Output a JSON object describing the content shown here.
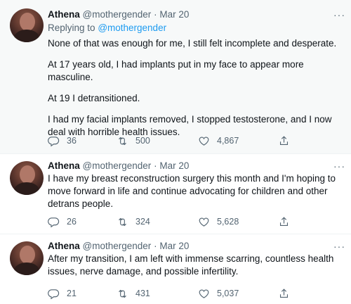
{
  "tweets": [
    {
      "name": "Athena",
      "handle": "@mothergender",
      "separator": "·",
      "date": "Mar 20",
      "replying_prefix": "Replying to",
      "replying_mention": "@mothergender",
      "paragraphs": [
        "None of that was enough for me, I still felt incomplete and desperate.",
        "At 17 years old, I had implants put in my face to appear more masculine.",
        "At 19 I detransitioned.",
        "I had my facial implants removed, I stopped testosterone, and I now deal with horrible health issues."
      ],
      "replies": "36",
      "retweets": "500",
      "likes": "4,867"
    },
    {
      "name": "Athena",
      "handle": "@mothergender",
      "separator": "·",
      "date": "Mar 20",
      "paragraphs": [
        "I have my breast reconstruction surgery this month and I'm hoping to move forward in life and continue advocating for children and other detrans people."
      ],
      "replies": "26",
      "retweets": "324",
      "likes": "5,628"
    },
    {
      "name": "Athena",
      "handle": "@mothergender",
      "separator": "·",
      "date": "Mar 20",
      "paragraphs": [
        "After my transition, I am left with immense scarring, countless health issues, nerve damage, and possible infertility."
      ],
      "replies": "21",
      "retweets": "431",
      "likes": "5,037"
    }
  ],
  "more_glyph": "···",
  "icons": {
    "reply": "reply-icon",
    "retweet": "retweet-icon",
    "like": "heart-icon",
    "share": "share-icon",
    "more": "more-icon"
  },
  "colors": {
    "text": "#0f1419",
    "muted": "#536471",
    "link": "#1d9bf0",
    "highlight_bg": "#f7f9f9"
  }
}
